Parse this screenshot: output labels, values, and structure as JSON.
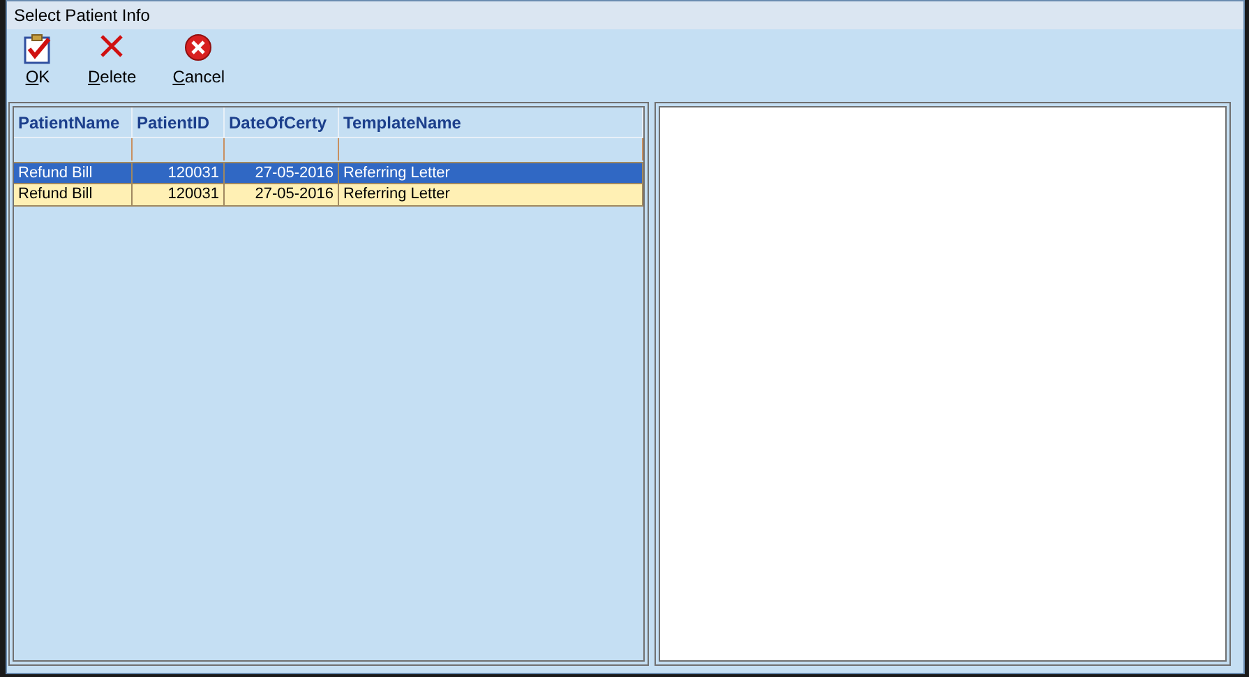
{
  "window": {
    "title": "Select Patient Info"
  },
  "toolbar": [
    {
      "kind": "ok",
      "key": "O",
      "rest": "K"
    },
    {
      "kind": "delete",
      "key": "D",
      "rest": "elete"
    },
    {
      "kind": "cancel",
      "key": "C",
      "rest": "ancel"
    }
  ],
  "table": {
    "columns": [
      "PatientName",
      "PatientID",
      "DateOfCerty",
      "TemplateName"
    ],
    "rows": [
      {
        "cells": [
          "Refund Bill",
          "120031",
          "27-05-2016",
          "Referring Letter"
        ],
        "selected": true
      },
      {
        "cells": [
          "Refund Bill",
          "120031",
          "27-05-2016",
          "Referring Letter"
        ],
        "selected": false
      }
    ]
  }
}
